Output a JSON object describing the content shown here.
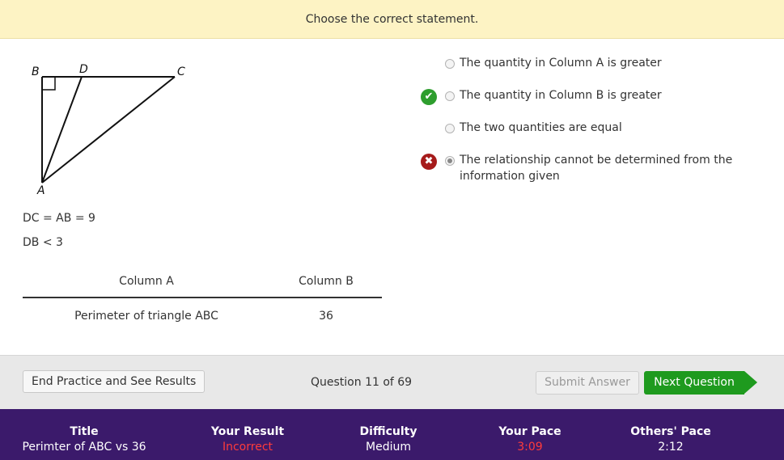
{
  "prompt": "Choose the correct statement.",
  "figure": {
    "labels": {
      "B": "B",
      "D": "D",
      "C": "C",
      "A": "A"
    }
  },
  "given": [
    "DC = AB = 9",
    "DB < 3"
  ],
  "columns": {
    "header_a": "Column A",
    "header_b": "Column B",
    "value_a": "Perimeter of triangle ABC",
    "value_b": "36"
  },
  "choices": [
    {
      "text": "The quantity in Column A is greater",
      "selected": false,
      "mark": null
    },
    {
      "text": "The quantity in Column B is greater",
      "selected": false,
      "mark": "correct"
    },
    {
      "text": "The two quantities are equal",
      "selected": false,
      "mark": null
    },
    {
      "text": "The relationship cannot be determined from the information given",
      "selected": true,
      "mark": "incorrect"
    }
  ],
  "footer": {
    "end_label": "End Practice and See Results",
    "question_counter": "Question 11 of 69",
    "submit_label": "Submit Answer",
    "next_label": "Next Question"
  },
  "stats": {
    "title_label": "Title",
    "title_value": "Perimter of ABC vs 36",
    "result_label": "Your Result",
    "result_value": "Incorrect",
    "difficulty_label": "Difficulty",
    "difficulty_value": "Medium",
    "pace_label": "Your Pace",
    "pace_value": "3:09",
    "others_label": "Others' Pace",
    "others_value": "2:12"
  },
  "colors": {
    "banner": "#fdf3c4",
    "correct": "#2e9e2e",
    "incorrect": "#a61b1b",
    "next_button": "#1e9a1e",
    "stats_bar": "#3b1a6b",
    "alert_text": "#ff3b3b"
  },
  "icons": {
    "correct": "check-icon",
    "incorrect": "x-icon",
    "next": "arrow-right-icon"
  }
}
